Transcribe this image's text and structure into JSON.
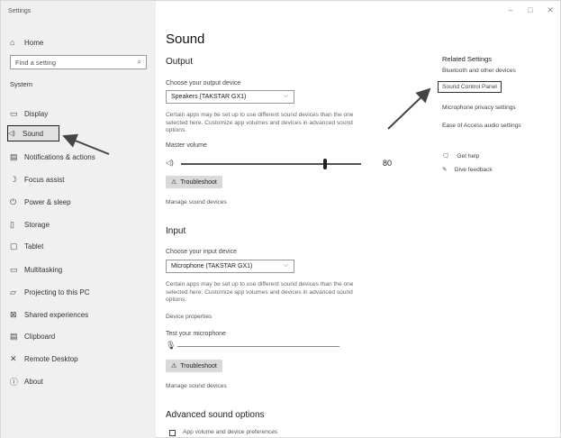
{
  "window": {
    "title": "Settings",
    "controls": [
      "–",
      "□",
      "✕"
    ]
  },
  "sidebar": {
    "home": "Home",
    "search_placeholder": "Find a setting",
    "section": "System",
    "items": [
      {
        "label": "Display",
        "icon": "display-icon",
        "glyph": "▭"
      },
      {
        "label": "Sound",
        "icon": "speaker-icon",
        "glyph": "🔊",
        "selected": true
      },
      {
        "label": "Notifications & actions",
        "icon": "notification-icon",
        "glyph": "▤"
      },
      {
        "label": "Focus assist",
        "icon": "moon-icon",
        "glyph": "☽"
      },
      {
        "label": "Power & sleep",
        "icon": "power-icon",
        "glyph": "⏻"
      },
      {
        "label": "Storage",
        "icon": "storage-icon",
        "glyph": "▯"
      },
      {
        "label": "Tablet",
        "icon": "tablet-icon",
        "glyph": "▢"
      },
      {
        "label": "Multitasking",
        "icon": "multitask-icon",
        "glyph": "▭"
      },
      {
        "label": "Projecting to this PC",
        "icon": "project-icon",
        "glyph": "▱"
      },
      {
        "label": "Shared experiences",
        "icon": "shared-icon",
        "glyph": "⊠"
      },
      {
        "label": "Clipboard",
        "icon": "clipboard-icon",
        "glyph": "▤"
      },
      {
        "label": "Remote Desktop",
        "icon": "remote-icon",
        "glyph": "✕"
      },
      {
        "label": "About",
        "icon": "info-icon",
        "glyph": "ⓘ"
      }
    ]
  },
  "main": {
    "title": "Sound",
    "output": {
      "heading": "Output",
      "choose_label": "Choose your output device",
      "device": "Speakers (TAKSTAR GX1)",
      "desc": "Certain apps may be set up to use different sound devices than the one selected here. Customize app volumes and devices in advanced sound options.",
      "volume_label": "Master volume",
      "volume_value": "80",
      "volume_level": 0.8,
      "troubleshoot": "Troubleshoot",
      "manage": "Manage sound devices"
    },
    "input": {
      "heading": "Input",
      "choose_label": "Choose your input device",
      "device": "Microphone (TAKSTAR GX1)",
      "desc": "Certain apps may be set up to use different sound devices than the one selected here. Customize app volumes and devices in advanced sound options.",
      "properties": "Device properties",
      "test_label": "Test your microphone",
      "troubleshoot": "Troubleshoot",
      "manage": "Manage sound devices"
    },
    "advanced": {
      "heading": "Advanced sound options",
      "app_volume": "App volume and device preferences"
    }
  },
  "related": {
    "title": "Related Settings",
    "links": [
      "Bluetooth and other devices",
      "Sound Control Panel",
      "Microphone privacy settings",
      "Ease of Access audio settings"
    ],
    "get_help": "Get help",
    "feedback": "Give feedback"
  }
}
